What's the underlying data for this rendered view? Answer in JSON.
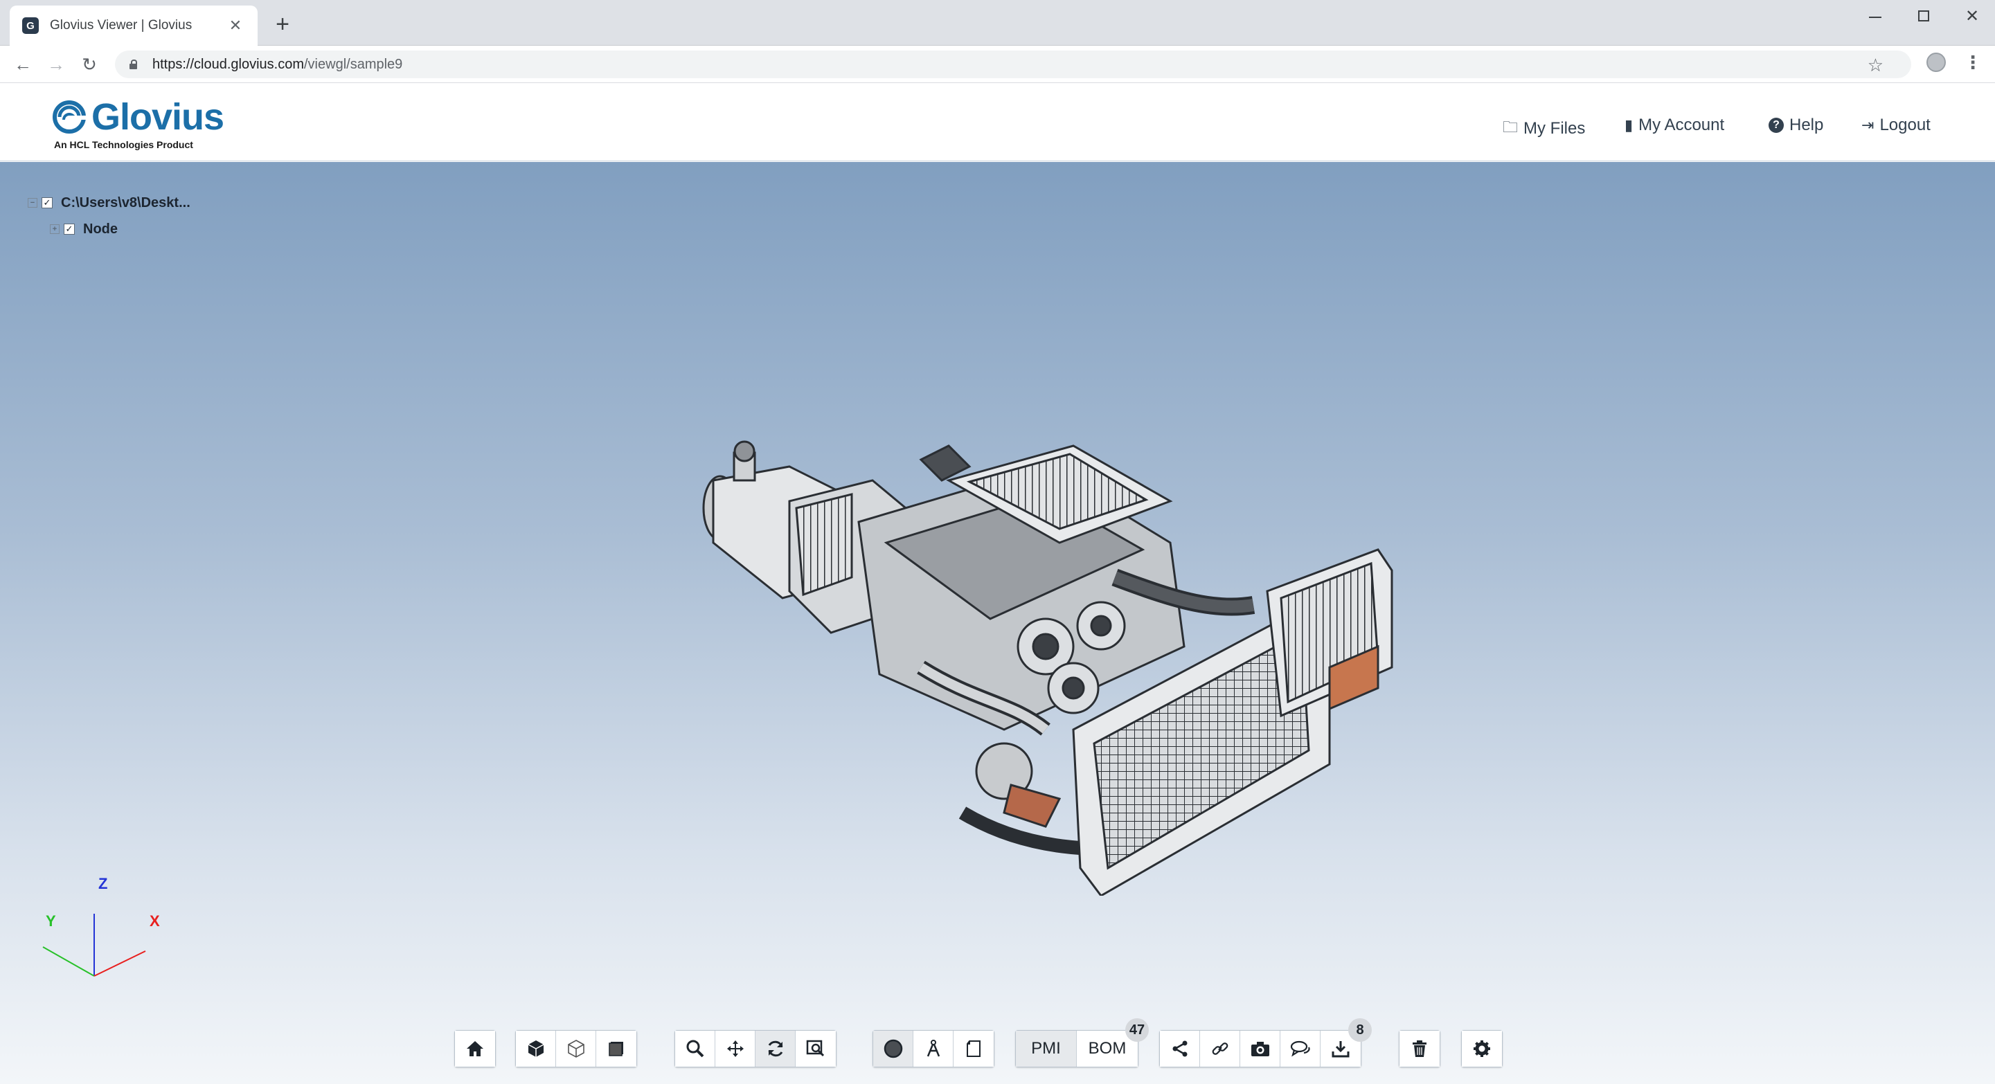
{
  "browser": {
    "tab_title": "Glovius Viewer | Glovius",
    "tab_favicon_letter": "G",
    "new_tab_label": "+",
    "url_host": "https://cloud.glovius.com",
    "url_path": "/viewgl/sample9",
    "icons": [
      "back-arrow-icon",
      "forward-arrow-icon",
      "reload-icon",
      "lock-icon",
      "star-icon",
      "profile-icon",
      "menu-icon"
    ]
  },
  "header": {
    "logo_text": "Glovius",
    "logo_sub": "An HCL Technologies Product",
    "nav": [
      {
        "label": "My Files",
        "icon": "files-icon"
      },
      {
        "label": "My Account",
        "icon": "account-icon"
      },
      {
        "label": "Help",
        "icon": "help-icon"
      },
      {
        "label": "Logout",
        "icon": "logout-icon"
      }
    ]
  },
  "tree": {
    "root_label": "C:\\Users\\v8\\Deskt...",
    "child_label": "Node",
    "root_checked": true,
    "child_checked": true
  },
  "triad": {
    "z_label": "Z",
    "y_label": "Y",
    "x_label": "X",
    "colors": {
      "x": "#e8201f",
      "y": "#28c12a",
      "z": "#2434d6"
    }
  },
  "toolbar": {
    "pmi_label": "PMI",
    "bom_label": "BOM",
    "bom_count": "47",
    "download_count": "8",
    "active_tool": "rotate"
  },
  "colors": {
    "brand": "#1c6fa8",
    "viewport_top": "#819fc0",
    "viewport_bottom": "#f3f6f9"
  }
}
